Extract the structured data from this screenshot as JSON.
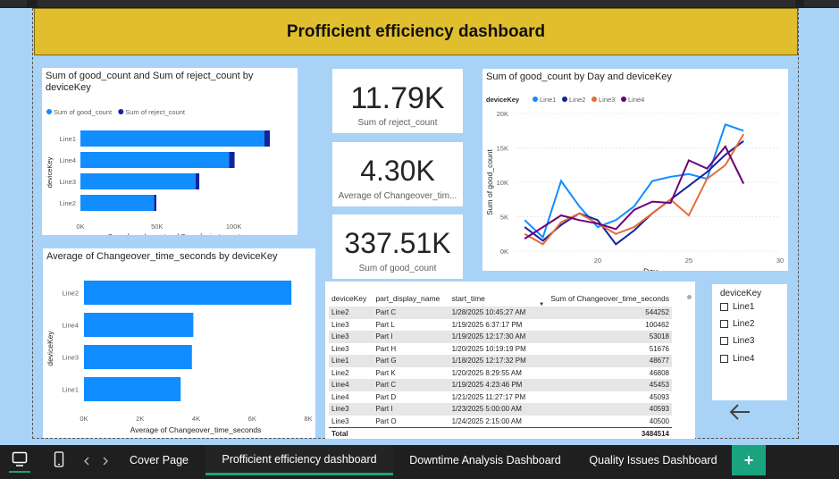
{
  "dashboard": {
    "title": "Profficient efficiency dashboard"
  },
  "colors": {
    "line1": "#118dff",
    "line2": "#12239e",
    "line3": "#e66c37",
    "line4": "#6b007b",
    "title_bg": "#e1be2d",
    "canvas_bg": "#a8d3f7",
    "tab_accent": "#1aa37f"
  },
  "kpis": [
    {
      "value": "11.79K",
      "label": "Sum of reject_count"
    },
    {
      "value": "4.30K",
      "label": "Average of Changeover_tim..."
    },
    {
      "value": "337.51K",
      "label": "Sum of good_count"
    }
  ],
  "chart_data": [
    {
      "type": "bar",
      "orientation": "horizontal",
      "stacked": true,
      "title": "Sum of good_count and Sum of reject_count by deviceKey",
      "xlabel": "Sum of good_count and Sum of reject_count",
      "ylabel": "deviceKey",
      "categories": [
        "Line1",
        "Line4",
        "Line3",
        "Line2"
      ],
      "series": [
        {
          "name": "Sum of good_count",
          "values": [
            120000,
            97000,
            75000,
            48000
          ]
        },
        {
          "name": "Sum of reject_count",
          "values": [
            3500,
            3500,
            2500,
            1500
          ]
        }
      ],
      "xlim": [
        0,
        120000
      ],
      "xticks": [
        "0K",
        "50K",
        "100K"
      ],
      "legend": "top-left"
    },
    {
      "type": "bar",
      "orientation": "horizontal",
      "title": "Average of Changeover_time_seconds by deviceKey",
      "xlabel": "Average of Changeover_time_seconds",
      "ylabel": "deviceKey",
      "categories": [
        "Line2",
        "Line4",
        "Line3",
        "Line1"
      ],
      "values": [
        7400,
        3900,
        3850,
        3450
      ],
      "xlim": [
        0,
        8000
      ],
      "xticks": [
        "0K",
        "2K",
        "4K",
        "6K",
        "8K"
      ]
    },
    {
      "type": "line",
      "title": "Sum of good_count by Day and deviceKey",
      "xlabel": "Day",
      "ylabel": "Sum of good_count",
      "legend_title": "deviceKey",
      "legend": "top-left",
      "xlim": [
        15.5,
        30
      ],
      "ylim": [
        0,
        20000
      ],
      "xticks": [
        20,
        25,
        30
      ],
      "yticks": [
        "0K",
        "5K",
        "10K",
        "15K",
        "20K"
      ],
      "series": [
        {
          "name": "Line1",
          "points": [
            [
              16,
              4500
            ],
            [
              17,
              2000
            ],
            [
              18,
              10200
            ],
            [
              19,
              6500
            ],
            [
              20,
              3500
            ],
            [
              21,
              4500
            ],
            [
              22,
              6500
            ],
            [
              23,
              10200
            ],
            [
              24,
              10800
            ],
            [
              25,
              11200
            ],
            [
              26,
              10500
            ],
            [
              27,
              18400
            ],
            [
              28,
              17500
            ]
          ]
        },
        {
          "name": "Line2",
          "points": [
            [
              16,
              3500
            ],
            [
              17,
              1500
            ],
            [
              18,
              3800
            ],
            [
              19,
              5500
            ],
            [
              20,
              4500
            ],
            [
              21,
              1000
            ],
            [
              22,
              3000
            ],
            [
              23,
              5500
            ],
            [
              24,
              7500
            ],
            [
              25,
              9500
            ],
            [
              26,
              11500
            ],
            [
              27,
              14000
            ],
            [
              28,
              16000
            ]
          ]
        },
        {
          "name": "Line3",
          "points": [
            [
              16,
              2500
            ],
            [
              17,
              1000
            ],
            [
              18,
              4200
            ],
            [
              19,
              5500
            ],
            [
              20,
              4000
            ],
            [
              21,
              2500
            ],
            [
              22,
              3500
            ],
            [
              23,
              5500
            ],
            [
              24,
              7500
            ],
            [
              25,
              5200
            ],
            [
              26,
              10500
            ],
            [
              27,
              12500
            ],
            [
              28,
              17000
            ]
          ]
        },
        {
          "name": "Line4",
          "points": [
            [
              16,
              1800
            ],
            [
              17,
              3500
            ],
            [
              18,
              5200
            ],
            [
              19,
              4500
            ],
            [
              20,
              4000
            ],
            [
              21,
              3200
            ],
            [
              22,
              6000
            ],
            [
              23,
              7200
            ],
            [
              24,
              7000
            ],
            [
              25,
              13200
            ],
            [
              26,
              12000
            ],
            [
              27,
              15200
            ],
            [
              28,
              9800
            ]
          ]
        }
      ]
    }
  ],
  "table": {
    "columns": [
      "deviceKey",
      "part_display_name",
      "start_time",
      "Sum of Changeover_time_seconds"
    ],
    "rows": [
      [
        "Line2",
        "Part C",
        "1/28/2025 10:45:27 AM",
        "544252"
      ],
      [
        "Line3",
        "Part L",
        "1/19/2025 6:37:17 PM",
        "100462"
      ],
      [
        "Line3",
        "Part I",
        "1/19/2025 12:17:30 AM",
        "53018"
      ],
      [
        "Line3",
        "Part H",
        "1/20/2025 10:19:19 PM",
        "51676"
      ],
      [
        "Line1",
        "Part G",
        "1/18/2025 12:17:32 PM",
        "48677"
      ],
      [
        "Line2",
        "Part K",
        "1/20/2025 8:29:55 AM",
        "46808"
      ],
      [
        "Line4",
        "Part C",
        "1/19/2025 4:23:46 PM",
        "45453"
      ],
      [
        "Line4",
        "Part D",
        "1/21/2025 11:27:17 PM",
        "45093"
      ],
      [
        "Line3",
        "Part I",
        "1/23/2025 5:00:00 AM",
        "40593"
      ],
      [
        "Line3",
        "Part O",
        "1/24/2025 2:15:00 AM",
        "40500"
      ]
    ],
    "total_label": "Total",
    "total_value": "3484514"
  },
  "slicer": {
    "title": "deviceKey",
    "items": [
      "Line1",
      "Line2",
      "Line3",
      "Line4"
    ]
  },
  "nav": {
    "back_icon": "arrow-left-icon"
  },
  "bottom_tabs": [
    "Cover Page",
    "Profficient efficiency dashboard",
    "Downtime Analysis Dashboard",
    "Quality Issues Dashboard"
  ],
  "active_tab": 1,
  "add_tab_label": "+"
}
